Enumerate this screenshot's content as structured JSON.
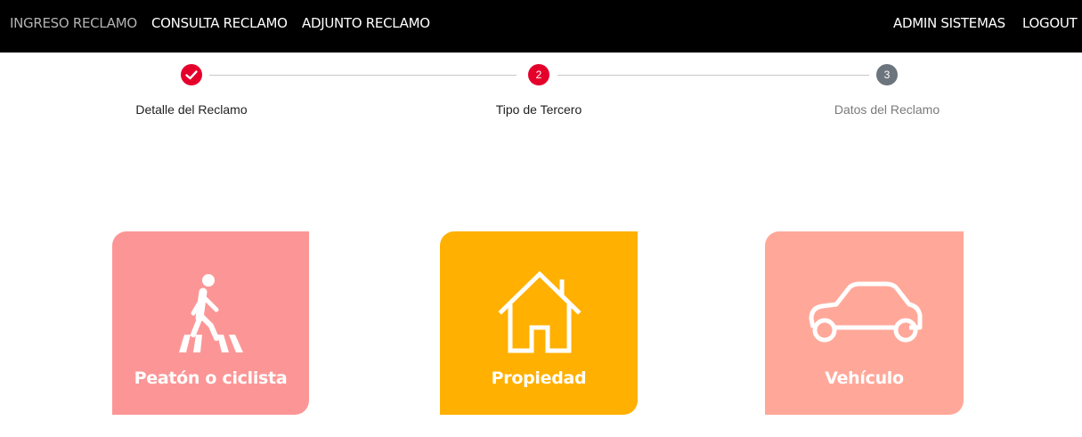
{
  "nav": {
    "left_items": [
      {
        "label": "INGRESO RECLAMO",
        "active": true
      },
      {
        "label": "CONSULTA RECLAMO",
        "active": false
      },
      {
        "label": "ADJUNTO RECLAMO",
        "active": false
      }
    ],
    "right_items": [
      {
        "label": "ADMIN SISTEMAS"
      },
      {
        "label": "LOGOUT"
      }
    ]
  },
  "stepper": {
    "steps": [
      {
        "number": "1",
        "label": "Detalle del Reclamo",
        "state": "completed"
      },
      {
        "number": "2",
        "label": "Tipo de Tercero",
        "state": "active"
      },
      {
        "number": "3",
        "label": "Datos del Reclamo",
        "state": "pending"
      }
    ],
    "colors": {
      "completed": "#e4002b",
      "active": "#e4002b",
      "pending": "#6c757d",
      "label_active": "#212121",
      "label_pending": "#7a7a7a"
    }
  },
  "options": [
    {
      "label": "Peatón o ciclista",
      "icon": "pedestrian-crossing-icon",
      "color": "#fc9696"
    },
    {
      "label": "Propiedad",
      "icon": "house-icon",
      "color": "#ffb000"
    },
    {
      "label": "Vehículo",
      "icon": "car-icon",
      "color": "#ffa89a"
    }
  ]
}
